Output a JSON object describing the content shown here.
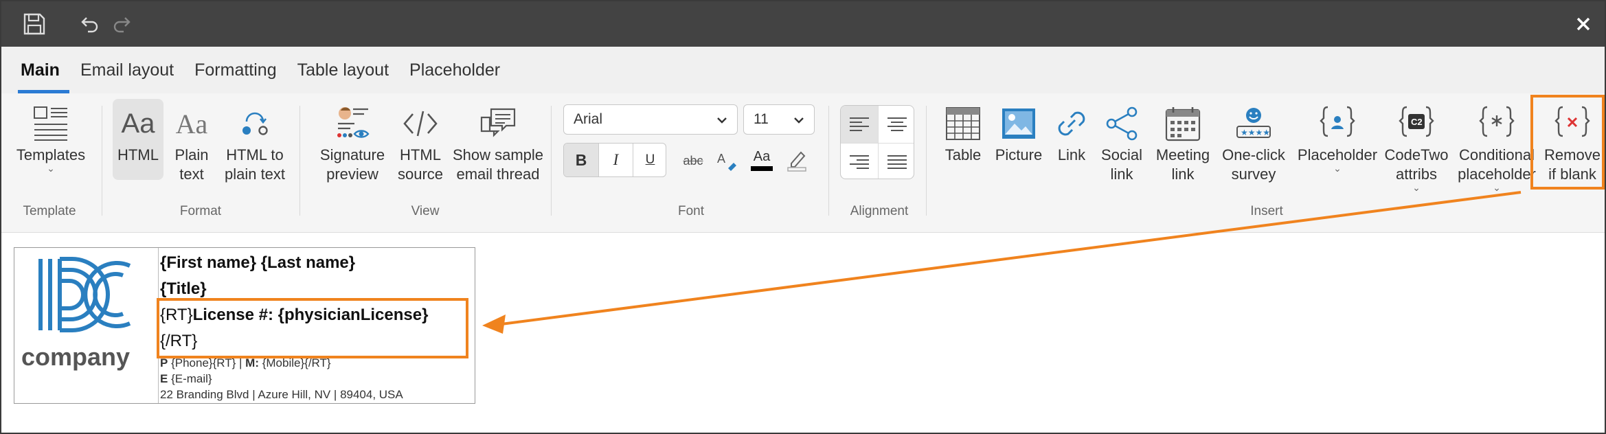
{
  "tabs": [
    {
      "label": "Main",
      "active": true
    },
    {
      "label": "Email layout"
    },
    {
      "label": "Formatting"
    },
    {
      "label": "Table layout"
    },
    {
      "label": "Placeholder"
    }
  ],
  "groups": {
    "template": "Template",
    "format": "Format",
    "view": "View",
    "font": "Font",
    "alignment": "Alignment",
    "insert": "Insert"
  },
  "buttons": {
    "templates": "Templates",
    "html": "HTML",
    "plain_text": "Plain\ntext",
    "html_to_plain": "HTML to\nplain text",
    "signature_preview": "Signature\npreview",
    "html_source": "HTML\nsource",
    "show_sample": "Show sample\nemail thread",
    "table": "Table",
    "picture": "Picture",
    "link": "Link",
    "social_link": "Social\nlink",
    "meeting_link": "Meeting\nlink",
    "one_click_survey": "One-click\nsurvey",
    "placeholder": "Placeholder",
    "codetwo_attribs": "CodeTwo\nattribs",
    "conditional_placeholder": "Conditional\nplaceholder",
    "remove_if_blank": "Remove\nif blank"
  },
  "font": {
    "family": "Arial",
    "size": "11",
    "bold": "B",
    "italic": "I",
    "underline": "U",
    "strike": "abc",
    "color_glyph": "Aa"
  },
  "signature": {
    "company": "company",
    "name_line": "{First name} {Last name}",
    "title_line": "{Title}",
    "rt_open": "{RT}",
    "license_line": "License #: {physicianLicense}",
    "rt_close": "{/RT}",
    "phone_label": "P",
    "phone_value": "{Phone}{RT} | ",
    "mobile_label": "M:",
    "mobile_value": " {Mobile}{/RT}",
    "email_label": "E",
    "email_value": " {E-mail}",
    "address": "22 Branding Blvd | Azure Hill, NV | 89404, USA"
  },
  "colors": {
    "accent": "#f0831e",
    "tab_underline": "#2b7bd4",
    "titlebar": "#434343",
    "logo_blue": "#2a7fc0"
  }
}
